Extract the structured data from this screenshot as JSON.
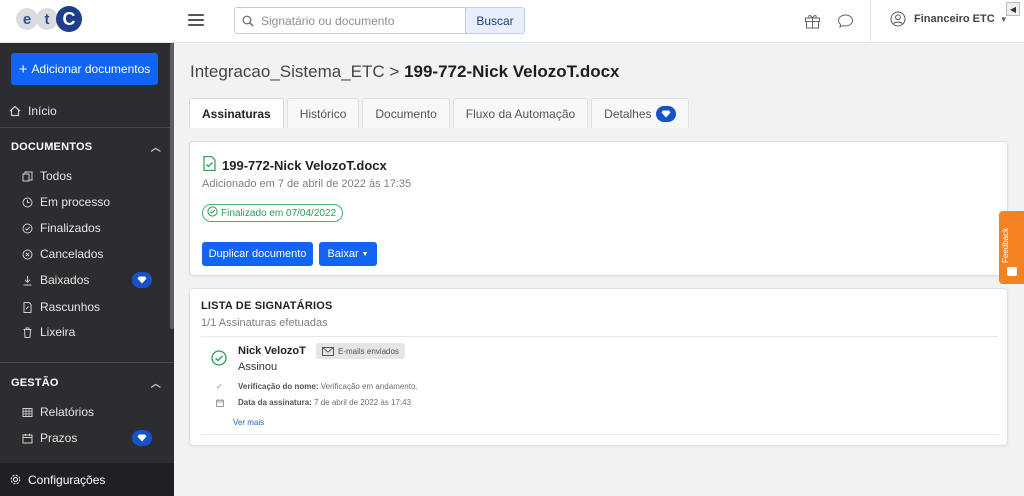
{
  "logo": {
    "letters": [
      "e",
      "t",
      "C"
    ]
  },
  "sidebar": {
    "add_button": "Adicionar documentos",
    "home": "Início",
    "documents_section": "DOCUMENTOS",
    "document_items": [
      "Todos",
      "Em processo",
      "Finalizados",
      "Cancelados",
      "Baixados",
      "Rascunhos",
      "Lixeira"
    ],
    "management_section": "GESTÃO",
    "management_items": [
      "Relatórios",
      "Prazos"
    ],
    "settings": "Configurações"
  },
  "topbar": {
    "search_placeholder": "Signatário ou documento",
    "search_button": "Buscar",
    "user_name": "Financeiro ETC"
  },
  "breadcrumb": {
    "parent": "Integracao_Sistema_ETC",
    "separator": ">",
    "current": "199-772-Nick VelozoT.docx"
  },
  "tabs": [
    "Assinaturas",
    "Histórico",
    "Documento",
    "Fluxo da Automação",
    "Detalhes"
  ],
  "document": {
    "title": "199-772-Nick VelozoT.docx",
    "added": "Adicionado em 7 de abril de 2022 às 17:35",
    "status_badge": "Finalizado em 07/04/2022",
    "duplicate_button": "Duplicar documento",
    "download_button": "Baixar"
  },
  "signers": {
    "title": "LISTA DE SIGNATÁRIOS",
    "subtitle": "1/1 Assinaturas efetuadas",
    "items": [
      {
        "name": "Nick VelozoT",
        "email_badge": "E-mails enviados",
        "status": "Assinou",
        "verification_label": "Verificação do nome:",
        "verification_value": "Verificação em andamento.",
        "date_label": "Data da assinatura:",
        "date_value": "7 de abril de 2022 às 17:43"
      }
    ],
    "see_more": "Ver mais"
  },
  "feedback": "Feedback",
  "colors": {
    "primary": "#1264f4",
    "sidebar_bg": "#2b2d30",
    "success": "#2f9c55",
    "premium": "#1852c8",
    "feedback": "#f58220"
  }
}
